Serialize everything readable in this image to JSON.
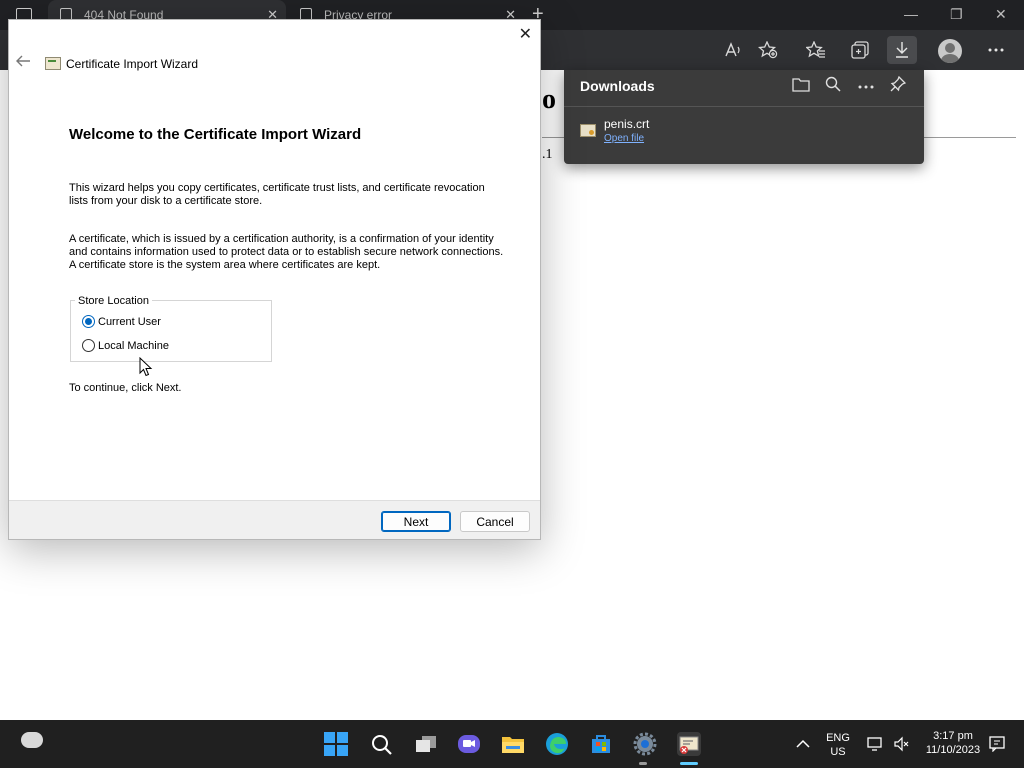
{
  "browser": {
    "tabs": [
      {
        "title": "404 Not Found"
      },
      {
        "title": "Privacy error"
      }
    ],
    "icons": [
      "tab-actions-icon",
      "read-aloud-icon",
      "add-favorite-icon",
      "favorites-icon",
      "collections-icon",
      "downloads-icon",
      "profile-icon",
      "more-icon"
    ]
  },
  "page": {
    "fragment_title": "o",
    "fragment_text": ".1"
  },
  "downloads": {
    "title": "Downloads",
    "items": [
      {
        "filename": "penis.crt",
        "action": "Open file"
      }
    ]
  },
  "dialog": {
    "title": "Certificate Import Wizard",
    "heading": "Welcome to the Certificate Import Wizard",
    "paragraph1": "This wizard helps you copy certificates, certificate trust lists, and certificate revocation lists from your disk to a certificate store.",
    "paragraph2": "A certificate, which is issued by a certification authority, is a confirmation of your identity and contains information used to protect data or to establish secure network connections. A certificate store is the system area where certificates are kept.",
    "store_location": {
      "legend": "Store Location",
      "options": [
        {
          "label": "Current User",
          "selected": true
        },
        {
          "label": "Local Machine",
          "selected": false
        }
      ]
    },
    "continue_text": "To continue, click Next.",
    "next_label": "Next",
    "cancel_label": "Cancel"
  },
  "taskbar": {
    "language": "ENG",
    "region": "US",
    "time": "3:17 pm",
    "date": "11/10/2023"
  },
  "colors": {
    "accent": "#0067c0",
    "taskbar": "#202020",
    "link": "#7fb2ff"
  }
}
